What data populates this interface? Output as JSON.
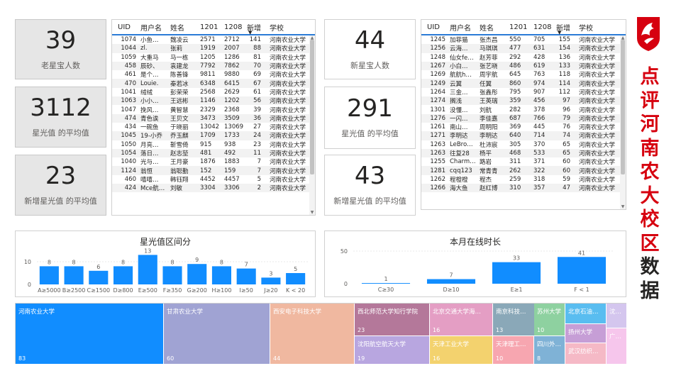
{
  "kpi_left": [
    {
      "value": "39",
      "label": "老星宝人数"
    },
    {
      "value": "3112",
      "label": "星光值 的平均值"
    },
    {
      "value": "23",
      "label": "新增星光值 的平均值"
    }
  ],
  "kpi_mid": [
    {
      "value": "44",
      "label": "新星宝人数"
    },
    {
      "value": "291",
      "label": "星光值 的平均值"
    },
    {
      "value": "43",
      "label": "新增星光值 的平均值"
    }
  ],
  "table_columns": [
    "UID",
    "用户名",
    "姓名",
    "1201",
    "1208",
    "新增",
    "学校"
  ],
  "table_left_rows": [
    [
      "1074",
      "小鱼…",
      "魏凌云",
      "2571",
      "2712",
      "141",
      "河南农业大学"
    ],
    [
      "1044",
      "zl.",
      "张莉",
      "1919",
      "2007",
      "88",
      "河南农业大学"
    ],
    [
      "1059",
      "大重马",
      "马一栋",
      "1205",
      "1286",
      "81",
      "河南农业大学"
    ],
    [
      "458",
      "辰砂、",
      "袁建龙",
      "7792",
      "7862",
      "70",
      "河南农业大学"
    ],
    [
      "461",
      "是个…",
      "陈善锋",
      "9811",
      "9880",
      "69",
      "河南农业大学"
    ],
    [
      "470",
      "Louie.",
      "秦若冰",
      "6348",
      "6415",
      "67",
      "河南农业大学"
    ],
    [
      "1041",
      "绒绒",
      "彭荣荣",
      "2568",
      "2629",
      "61",
      "河南农业大学"
    ],
    [
      "1063",
      "小小…",
      "王远彬",
      "1146",
      "1202",
      "56",
      "河南农业大学"
    ],
    [
      "1047",
      "挽风…",
      "黄智慧",
      "2329",
      "2368",
      "39",
      "河南农业大学"
    ],
    [
      "474",
      "青色诶",
      "王贝文",
      "3473",
      "3509",
      "36",
      "河南农业大学"
    ],
    [
      "434",
      "一碗鱼",
      "于晓丽",
      "13042",
      "13069",
      "27",
      "河南农业大学"
    ],
    [
      "1045",
      "19-小乔",
      "乔玉麒",
      "1709",
      "1733",
      "24",
      "河南农业大学"
    ],
    [
      "1050",
      "月亮…",
      "靳雪倚",
      "915",
      "938",
      "23",
      "河南农业大学"
    ],
    [
      "1054",
      "落日…",
      "赵志堃",
      "481",
      "492",
      "11",
      "河南农业大学"
    ],
    [
      "1040",
      "光与…",
      "王月豪",
      "1876",
      "1883",
      "7",
      "河南农业大学"
    ],
    [
      "1124",
      "翁恒",
      "翁聪勤",
      "152",
      "159",
      "7",
      "河南农业大学"
    ],
    [
      "460",
      "嘻嘻…",
      "韩钰翔",
      "4452",
      "4457",
      "5",
      "河南农业大学"
    ],
    [
      "424",
      "Mce航…",
      "刘敏",
      "3304",
      "3306",
      "2",
      "河南农业大学"
    ]
  ],
  "table_right_rows": [
    [
      "1245",
      "加菲猫",
      "张杰昌",
      "550",
      "705",
      "155",
      "河南农业大学"
    ],
    [
      "1256",
      "云海…",
      "马琪琪",
      "477",
      "631",
      "154",
      "河南农业大学"
    ],
    [
      "1248",
      "仙女fe…",
      "赵芳菲",
      "292",
      "428",
      "136",
      "河南农业大学"
    ],
    [
      "1267",
      "小白…",
      "张艺晓",
      "486",
      "619",
      "133",
      "河南农业大学"
    ],
    [
      "1269",
      "航航h…",
      "周宇航",
      "645",
      "763",
      "118",
      "河南农业大学"
    ],
    [
      "1249",
      "云翼",
      "任翼",
      "860",
      "974",
      "114",
      "河南农业大学"
    ],
    [
      "1264",
      "三金…",
      "张鑫彤",
      "795",
      "907",
      "112",
      "河南农业大学"
    ],
    [
      "1274",
      "搁浅",
      "王英瑞",
      "359",
      "456",
      "97",
      "河南农业大学"
    ],
    [
      "1301",
      "没懂…",
      "刘航",
      "282",
      "378",
      "96",
      "河南农业大学"
    ],
    [
      "1276",
      "一闪…",
      "李佳嘉",
      "687",
      "766",
      "79",
      "河南农业大学"
    ],
    [
      "1261",
      "南山…",
      "周明阳",
      "369",
      "445",
      "76",
      "河南农业大学"
    ],
    [
      "1271",
      "李明达",
      "李明达",
      "640",
      "714",
      "74",
      "河南农业大学"
    ],
    [
      "1263",
      "LeBro…",
      "杜沛宸",
      "305",
      "370",
      "65",
      "河南农业大学"
    ],
    [
      "1263",
      "往复28",
      "杨平",
      "468",
      "533",
      "65",
      "河南农业大学"
    ],
    [
      "1255",
      "Charm…",
      "路岩",
      "311",
      "371",
      "60",
      "河南农业大学"
    ],
    [
      "1281",
      "cqq123",
      "常青青",
      "262",
      "322",
      "60",
      "河南农业大学"
    ],
    [
      "1262",
      "程橙橙",
      "程杰",
      "259",
      "318",
      "59",
      "河南农业大学"
    ],
    [
      "1266",
      "海大鱼",
      "赵红博",
      "310",
      "357",
      "47",
      "河南农业大学"
    ]
  ],
  "chart_data": [
    {
      "type": "bar",
      "title": "星光值区间分",
      "categories": [
        "A≥5000",
        "B≥2500",
        "C≥1500",
        "D≥800",
        "E≥500",
        "F≥350",
        "G≥200",
        "H≥100",
        "I≥50",
        "J≥20",
        "K < 20"
      ],
      "values": [
        8,
        8,
        6,
        8,
        13,
        8,
        9,
        8,
        7,
        3,
        5
      ],
      "yticks": [
        "10",
        "0"
      ],
      "ylim": [
        0,
        15
      ]
    },
    {
      "type": "bar",
      "title": "本月在线时长",
      "categories": [
        "C≥30",
        "D≥10",
        "E≥1",
        "F < 1"
      ],
      "values": [
        1,
        7,
        33,
        41
      ],
      "yticks": [
        "50",
        "0"
      ],
      "ylim": [
        0,
        50
      ]
    }
  ],
  "treemap": [
    {
      "label": "河南农业大学",
      "value": "83",
      "color": "#118dff"
    },
    {
      "label": "甘肃农业大学",
      "value": "60",
      "color": "#a0a3d3"
    },
    {
      "label": "西安电子科技大学",
      "value": "44",
      "color": "#f0b8a0"
    },
    {
      "label": "西北师范大学知行学院",
      "value": "23",
      "color": "#b4789a"
    },
    {
      "label": "沈阳航空航天大学",
      "value": "19",
      "color": "#b8a6e0"
    },
    {
      "label": "北京交通大学海…",
      "value": "16",
      "color": "#e49ec4"
    },
    {
      "label": "天津工业大学",
      "value": "16",
      "color": "#f3d26e"
    },
    {
      "label": "南京科技…",
      "value": "13",
      "color": "#8aa8b8"
    },
    {
      "label": "天津理工…",
      "value": "10",
      "color": "#f7a6b0"
    },
    {
      "label": "苏州大学",
      "value": "10",
      "color": "#8ed1a0"
    },
    {
      "label": "四川外…",
      "value": "8",
      "color": "#7fb2d6"
    },
    {
      "label": "北京石油…",
      "value": "",
      "color": "#59bdf0"
    },
    {
      "label": "扬州大学",
      "value": "",
      "color": "#c69ed6"
    },
    {
      "label": "武汉纺织…",
      "value": "",
      "color": "#f5b9c6"
    },
    {
      "label": "沈…",
      "value": "",
      "color": "#d4c6ee"
    },
    {
      "label": "广…",
      "value": "",
      "color": "#f6c6ec"
    }
  ],
  "side_title": [
    "点",
    "评",
    "河",
    "南",
    "农",
    "大",
    "校",
    "区",
    "数",
    "据"
  ],
  "colors": {
    "accent": "#118dff",
    "title_red": "#d6000f",
    "logo_red": "#d6000f"
  }
}
